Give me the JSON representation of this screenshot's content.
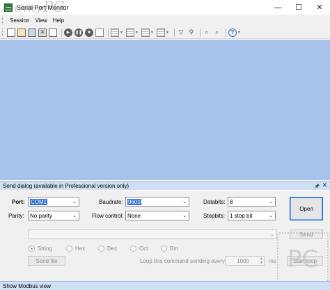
{
  "window": {
    "title": "Serial Port Monitor",
    "watermark_a": "Activity",
    "watermark_b": "PC",
    "minimize": "—",
    "maximize": "☐",
    "close": "✕"
  },
  "menu": {
    "items": [
      "Session",
      "View",
      "Help"
    ]
  },
  "toolbar": {
    "icons": [
      "new-session-icon",
      "open-session-icon",
      "save-icon",
      "close-session-icon",
      "copy-icon",
      "start-icon",
      "pause-icon",
      "stop-icon",
      "view-icon",
      "table-view-icon",
      "dump-view-icon",
      "line-view-icon",
      "terminal-view-icon",
      "filter-icon",
      "filter-settings-icon",
      "search-icon",
      "find-next-icon",
      "help-icon"
    ]
  },
  "send_dialog": {
    "title": "Send dialog (available in Professional version only)",
    "pin_icon": "🖈",
    "close_icon": "✕",
    "port_label": "Port:",
    "port_value": "COM1",
    "parity_label": "Parity:",
    "parity_value": "No parity",
    "baudrate_label": "Baudrate:",
    "baudrate_value": "9600",
    "flow_label": "Flow control:",
    "flow_value": "None",
    "databits_label": "Databits:",
    "databits_value": "8",
    "stopbits_label": "Stopbits:",
    "stopbits_value": "1 stop bit",
    "open_button": "Open",
    "send_button": "Send",
    "modes": [
      "String",
      "Hex",
      "Dec",
      "Oct",
      "Bin"
    ],
    "selected_mode": "String",
    "send_file_button": "Send file",
    "loop_label": "Loop this command sending every",
    "loop_value": "1000",
    "loop_unit": "ms",
    "start_loop_button": "Start loop"
  },
  "status": {
    "text": "Show Modbus view"
  },
  "logo": {
    "text": "PC"
  }
}
